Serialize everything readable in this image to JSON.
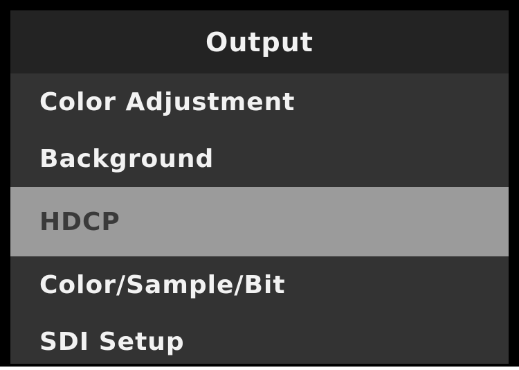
{
  "menu": {
    "title": "Output",
    "items": [
      {
        "label": "Color Adjustment",
        "selected": false
      },
      {
        "label": "Background",
        "selected": false
      },
      {
        "label": "HDCP",
        "selected": true
      },
      {
        "label": "Color/Sample/Bit",
        "selected": false
      },
      {
        "label": "SDI Setup",
        "selected": false
      }
    ],
    "colors": {
      "background": "#333333",
      "title_background": "#232323",
      "selected_background": "#9b9b9b",
      "text": "#f2f2f2",
      "selected_text": "#3a3a3a",
      "border": "#000000"
    }
  }
}
